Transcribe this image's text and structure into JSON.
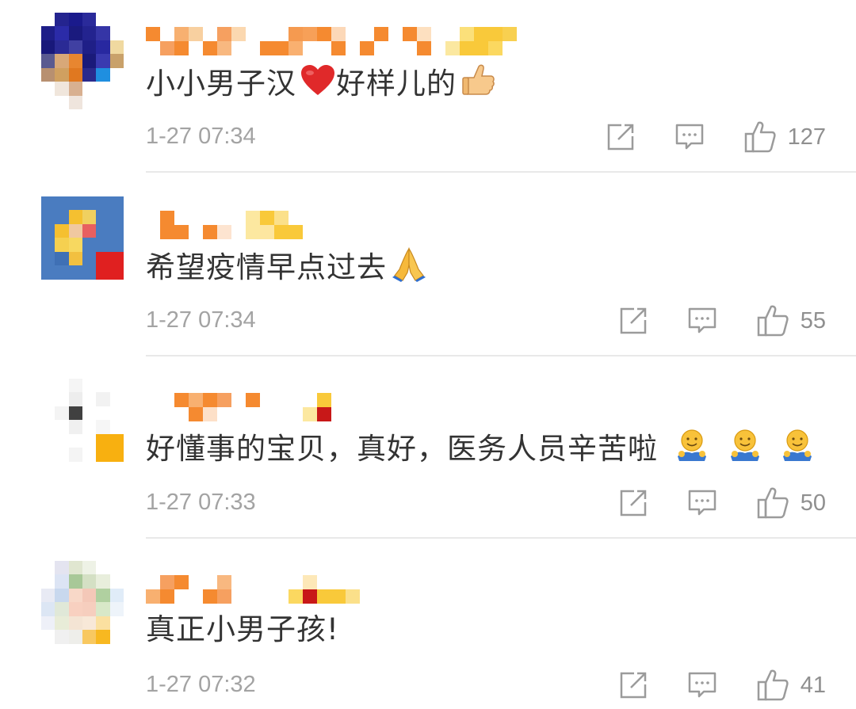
{
  "comments": [
    {
      "text": "小小男子汉",
      "text2": "好样儿的",
      "time": "1-27 07:34",
      "likes": "127",
      "emojis": [
        "red-heart",
        "thumbs-up"
      ]
    },
    {
      "text": "希望疫情早点过去",
      "time": "1-27 07:34",
      "likes": "55",
      "emojis": [
        "folded-hands"
      ]
    },
    {
      "text": "好懂事的宝贝，真好，医务人员辛苦啦",
      "time": "1-27 07:33",
      "likes": "50",
      "emojis": [
        "hugging-face",
        "hugging-face",
        "hugging-face"
      ]
    },
    {
      "text": "真正小男子孩!",
      "time": "1-27 07:32",
      "likes": "41",
      "emojis": []
    }
  ],
  "icons": {
    "share": "share-icon",
    "reply": "comment-icon",
    "like": "thumbs-up-icon"
  },
  "colors": {
    "text": "#333333",
    "meta": "#a3a3a3",
    "divider": "#e9e9e9",
    "username_mosaic": "#f07a1a"
  }
}
